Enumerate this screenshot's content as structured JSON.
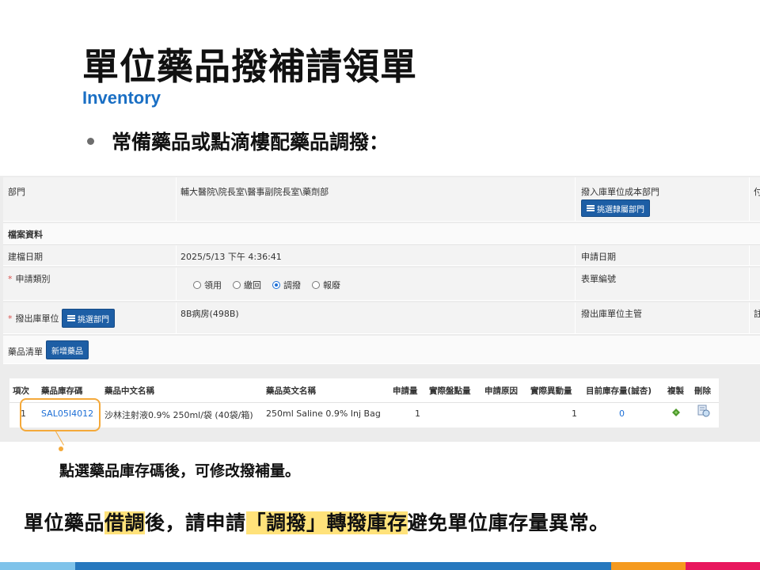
{
  "slide": {
    "title": "單位藥品撥補請領單",
    "subtitle": "Inventory",
    "bullet": "常備藥品或點滴樓配藥品調撥："
  },
  "form": {
    "dept_label": "部門",
    "dept_value": "輔大醫院\\院長室\\醫事副院長室\\藥劑部",
    "dept_cost_label": "撥入庫單位成本部門",
    "select_dept_sub_btn": "挑選隸屬部門",
    "file_section": "檔案資料",
    "created_date_label": "建檔日期",
    "created_date_value": "2025/5/13 下午 4:36:41",
    "apply_date_label": "申請日期",
    "apply_type_label": "申請類別",
    "apply_type_options": [
      "領用",
      "繳回",
      "調撥",
      "報廢"
    ],
    "apply_type_selected": "調撥",
    "form_no_label": "表單編號",
    "out_unit_label": "撥出庫單位",
    "select_dept_btn": "挑選部門",
    "out_unit_value": "8B病房(498B)",
    "out_unit_manager_label": "撥出庫單位主管",
    "drug_list_label": "藥品清單",
    "add_drug_btn": "新增藥品",
    "right_edge_1": "付",
    "right_edge_2": "註"
  },
  "table": {
    "headers": [
      "項次",
      "藥品庫存碼",
      "藥品中文名稱",
      "藥品英文名稱",
      "申請量",
      "實際盤點量",
      "申請原因",
      "實際異動量",
      "目前庫存量(誠杏)",
      "複製",
      "刪除"
    ],
    "rows": [
      {
        "idx": "1",
        "code": "SAL05I4012",
        "cname": "沙林注射液0.9% 250ml/袋 (40袋/箱)",
        "ename": "250ml Saline 0.9% Inj Bag",
        "qty": "1",
        "actual_qty": "1",
        "stock": "0"
      }
    ]
  },
  "callout": "點選藥品庫存碼後，可修改撥補量。",
  "bottom": {
    "p1": "單位藥品",
    "h1": "借調",
    "p2": "後，請申請",
    "h2": "「調撥」轉撥庫存",
    "p3": "避免單位庫存量異常。"
  },
  "colors": {
    "accent_blue": "#1d5ea5",
    "link_blue": "#1d6fd6",
    "highlight": "#ffe27a",
    "callout_orange": "#f4a93a"
  }
}
